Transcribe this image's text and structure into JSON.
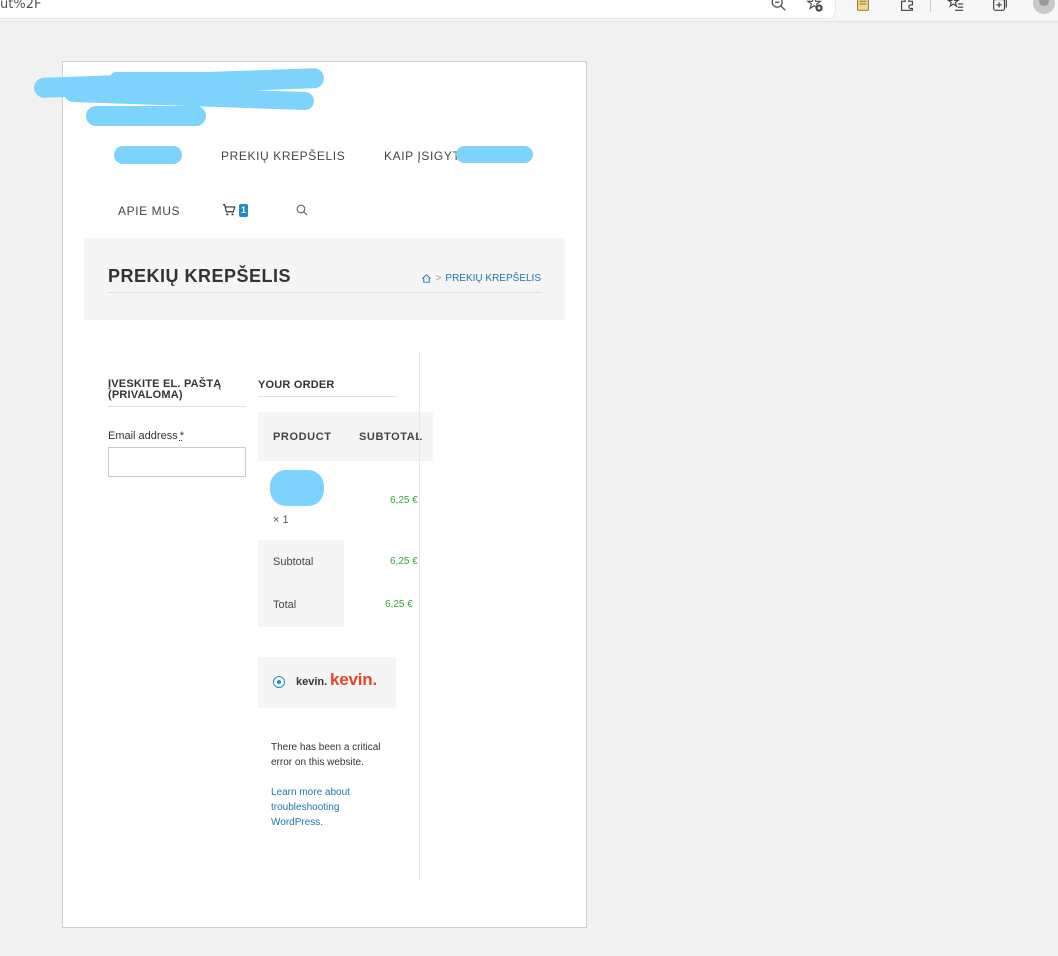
{
  "browser": {
    "url_fragment": "ut%2F",
    "icons": [
      "zoom-out-icon",
      "add-favorite-icon",
      "notes-icon",
      "extensions-icon",
      "favorites-list-icon",
      "collections-icon",
      "profile-icon"
    ]
  },
  "nav": {
    "items": [
      "PREKIŲ KREPŠELIS",
      "KAIP ĮSIGYTI",
      "APIE MUS"
    ],
    "cart_count": "1"
  },
  "page_header": {
    "title": "PREKIŲ KREPŠELIS",
    "breadcrumb_separator": ">",
    "breadcrumb_current": "PREKIŲ KREPŠELIS"
  },
  "email_section": {
    "heading": "ĮVESKITE EL. PAŠTĄ (PRIVALOMA)",
    "label": "Email address",
    "required_mark": "*",
    "value": ""
  },
  "order": {
    "heading": "YOUR ORDER",
    "col_product": "PRODUCT",
    "col_subtotal": "SUBTOTAL",
    "item_qty": "× 1",
    "item_price": "6,25 €",
    "subtotal_label": "Subtotal",
    "subtotal_value": "6,25 €",
    "total_label": "Total",
    "total_value": "6,25 €"
  },
  "payment": {
    "method_name": "kevin.",
    "logo_text": "kevin."
  },
  "error": {
    "message": "There has been a critical error on this website.",
    "link_text": "Learn more about troubleshooting WordPress."
  },
  "colors": {
    "accent": "#1b8fc6",
    "price_green": "#3aa33a",
    "kevin_red": "#e3452a",
    "redaction": "#7dd3fb"
  }
}
